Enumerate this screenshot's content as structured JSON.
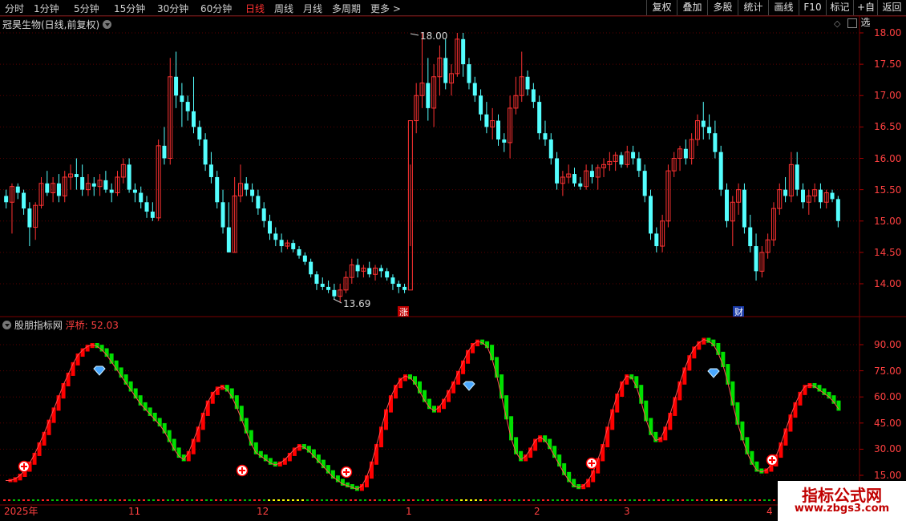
{
  "toolbar": {
    "periods": [
      "分时",
      "1分钟",
      "5分钟",
      "15分钟",
      "30分钟",
      "60分钟",
      "日线",
      "周线",
      "月线",
      "多周期",
      "更多 >"
    ],
    "active_period": "日线",
    "buttons": [
      "复权",
      "叠加",
      "多股",
      "统计",
      "画线",
      "F10",
      "标记",
      "+自选",
      "返回"
    ]
  },
  "main_panel": {
    "title": "冠昊生物(日线,前复权)",
    "high_label": "18.00",
    "low_label": "13.69",
    "zhang_marker": "涨",
    "cai_marker": "财",
    "yaxis": [
      "18.00",
      "17.50",
      "17.00",
      "16.50",
      "16.00",
      "15.50",
      "15.00",
      "14.50",
      "14.00"
    ]
  },
  "indicator_panel": {
    "title": "股朋指标网",
    "value_label": "浮桥: 52.03",
    "yaxis": [
      "90.00",
      "75.00",
      "60.00",
      "45.00",
      "30.00",
      "15.00"
    ]
  },
  "xaxis": [
    "2025年",
    "11",
    "12",
    "1",
    "2",
    "3",
    "4"
  ],
  "watermark": {
    "line1": "指标公式网",
    "line2": "www.zbgs3.com"
  },
  "colors": {
    "up": "#ff3232",
    "down": "#54ffff",
    "ind_up": "#ff0000",
    "ind_down": "#00e000"
  },
  "chart_data": {
    "type": "candlestick",
    "candles": [
      [
        15.4,
        15.5,
        15.2,
        15.3
      ],
      [
        15.3,
        15.6,
        14.8,
        15.55
      ],
      [
        15.55,
        15.6,
        15.35,
        15.45
      ],
      [
        15.45,
        15.5,
        15.1,
        15.2
      ],
      [
        15.2,
        15.3,
        14.6,
        14.9
      ],
      [
        14.9,
        15.3,
        14.7,
        15.25
      ],
      [
        15.25,
        15.7,
        15.2,
        15.6
      ],
      [
        15.6,
        15.8,
        15.4,
        15.45
      ],
      [
        15.45,
        15.7,
        15.3,
        15.6
      ],
      [
        15.6,
        15.75,
        15.3,
        15.4
      ],
      [
        15.4,
        15.8,
        15.3,
        15.7
      ],
      [
        15.7,
        15.9,
        15.5,
        15.75
      ],
      [
        15.75,
        16.0,
        15.5,
        15.7
      ],
      [
        15.7,
        15.9,
        15.4,
        15.5
      ],
      [
        15.5,
        15.75,
        15.4,
        15.6
      ],
      [
        15.6,
        15.7,
        15.4,
        15.55
      ],
      [
        15.55,
        15.75,
        15.4,
        15.65
      ],
      [
        15.65,
        15.8,
        15.45,
        15.5
      ],
      [
        15.5,
        15.6,
        15.3,
        15.45
      ],
      [
        15.45,
        15.8,
        15.4,
        15.7
      ],
      [
        15.7,
        16.0,
        15.6,
        15.9
      ],
      [
        15.9,
        16.0,
        15.45,
        15.5
      ],
      [
        15.5,
        15.6,
        15.3,
        15.45
      ],
      [
        15.45,
        15.55,
        15.2,
        15.3
      ],
      [
        15.3,
        15.4,
        15.05,
        15.15
      ],
      [
        15.15,
        15.3,
        15.0,
        15.05
      ],
      [
        15.05,
        16.3,
        15.0,
        16.2
      ],
      [
        16.2,
        16.5,
        15.9,
        16.0
      ],
      [
        16.0,
        17.6,
        15.9,
        17.3
      ],
      [
        17.3,
        17.7,
        16.8,
        17.0
      ],
      [
        17.0,
        17.2,
        16.5,
        16.9
      ],
      [
        16.9,
        17.0,
        16.6,
        16.75
      ],
      [
        16.75,
        17.3,
        16.4,
        16.5
      ],
      [
        16.5,
        16.6,
        16.2,
        16.3
      ],
      [
        16.3,
        16.4,
        15.8,
        15.9
      ],
      [
        15.9,
        16.1,
        15.6,
        15.7
      ],
      [
        15.7,
        15.8,
        15.2,
        15.3
      ],
      [
        15.3,
        15.5,
        14.8,
        14.9
      ],
      [
        14.9,
        15.3,
        14.5,
        14.5
      ],
      [
        14.5,
        15.7,
        14.5,
        15.4
      ],
      [
        15.4,
        15.9,
        15.3,
        15.6
      ],
      [
        15.6,
        15.7,
        15.4,
        15.5
      ],
      [
        15.5,
        15.6,
        15.3,
        15.4
      ],
      [
        15.4,
        15.5,
        15.1,
        15.2
      ],
      [
        15.2,
        15.3,
        14.9,
        15.0
      ],
      [
        15.0,
        15.1,
        14.7,
        14.8
      ],
      [
        14.8,
        14.9,
        14.6,
        14.7
      ],
      [
        14.7,
        14.8,
        14.5,
        14.6
      ],
      [
        14.6,
        14.7,
        14.55,
        14.65
      ],
      [
        14.65,
        14.7,
        14.5,
        14.55
      ],
      [
        14.55,
        14.6,
        14.4,
        14.45
      ],
      [
        14.45,
        14.5,
        14.3,
        14.35
      ],
      [
        14.35,
        14.4,
        14.1,
        14.15
      ],
      [
        14.15,
        14.2,
        13.9,
        14.0
      ],
      [
        14.0,
        14.1,
        13.9,
        13.95
      ],
      [
        13.95,
        14.05,
        13.85,
        13.9
      ],
      [
        13.9,
        14.0,
        13.75,
        13.8
      ],
      [
        13.8,
        14.0,
        13.7,
        13.9
      ],
      [
        13.9,
        14.2,
        13.85,
        14.1
      ],
      [
        14.1,
        14.4,
        14.0,
        14.3
      ],
      [
        14.3,
        14.4,
        14.1,
        14.2
      ],
      [
        14.2,
        14.3,
        14.1,
        14.25
      ],
      [
        14.25,
        14.35,
        14.1,
        14.15
      ],
      [
        14.15,
        14.3,
        14.05,
        14.25
      ],
      [
        14.25,
        14.3,
        14.1,
        14.2
      ],
      [
        14.2,
        14.25,
        14.05,
        14.1
      ],
      [
        14.1,
        14.15,
        13.9,
        14.0
      ],
      [
        14.0,
        14.05,
        13.85,
        13.95
      ],
      [
        13.95,
        14.0,
        13.85,
        13.9
      ],
      [
        13.9,
        15.9,
        14.6,
        16.6
      ],
      [
        16.6,
        17.2,
        16.4,
        17.0
      ],
      [
        17.0,
        18.0,
        16.8,
        17.2
      ],
      [
        17.2,
        17.6,
        16.6,
        16.8
      ],
      [
        16.8,
        17.5,
        16.5,
        17.3
      ],
      [
        17.3,
        17.8,
        17.0,
        17.6
      ],
      [
        17.6,
        17.9,
        17.1,
        17.2
      ],
      [
        17.2,
        17.5,
        17.0,
        17.35
      ],
      [
        17.35,
        18.0,
        17.3,
        17.9
      ],
      [
        17.9,
        18.0,
        17.3,
        17.5
      ],
      [
        17.5,
        17.6,
        17.1,
        17.2
      ],
      [
        17.2,
        17.3,
        16.9,
        17.0
      ],
      [
        17.0,
        17.1,
        16.6,
        16.7
      ],
      [
        16.7,
        16.9,
        16.4,
        16.5
      ],
      [
        16.5,
        16.8,
        16.3,
        16.6
      ],
      [
        16.6,
        16.7,
        16.2,
        16.3
      ],
      [
        16.3,
        16.4,
        16.1,
        16.25
      ],
      [
        16.25,
        17.0,
        16.0,
        16.8
      ],
      [
        16.8,
        17.3,
        16.7,
        17.0
      ],
      [
        17.0,
        17.7,
        16.9,
        17.3
      ],
      [
        17.3,
        17.4,
        17.0,
        17.1
      ],
      [
        17.1,
        17.2,
        16.8,
        16.9
      ],
      [
        16.9,
        17.0,
        16.3,
        16.4
      ],
      [
        16.4,
        16.6,
        16.2,
        16.3
      ],
      [
        16.3,
        16.4,
        15.9,
        16.0
      ],
      [
        16.0,
        16.1,
        15.5,
        15.6
      ],
      [
        15.6,
        15.8,
        15.4,
        15.7
      ],
      [
        15.7,
        15.9,
        15.6,
        15.75
      ],
      [
        15.75,
        15.85,
        15.55,
        15.6
      ],
      [
        15.6,
        15.7,
        15.5,
        15.55
      ],
      [
        15.55,
        15.9,
        15.5,
        15.8
      ],
      [
        15.8,
        15.9,
        15.6,
        15.7
      ],
      [
        15.7,
        15.9,
        15.5,
        15.85
      ],
      [
        15.85,
        16.0,
        15.7,
        15.9
      ],
      [
        15.9,
        16.1,
        15.8,
        15.95
      ],
      [
        15.95,
        16.1,
        15.8,
        16.05
      ],
      [
        16.05,
        16.1,
        15.85,
        15.9
      ],
      [
        15.9,
        16.2,
        15.85,
        16.1
      ],
      [
        16.1,
        16.2,
        15.9,
        16.0
      ],
      [
        16.0,
        16.1,
        15.7,
        15.8
      ],
      [
        15.8,
        15.9,
        15.3,
        15.4
      ],
      [
        15.4,
        15.5,
        14.7,
        14.8
      ],
      [
        14.8,
        14.9,
        14.5,
        14.6
      ],
      [
        14.6,
        15.1,
        14.5,
        15.0
      ],
      [
        15.0,
        15.9,
        14.9,
        15.8
      ],
      [
        15.8,
        16.1,
        15.7,
        16.0
      ],
      [
        16.0,
        16.2,
        15.8,
        16.15
      ],
      [
        16.15,
        16.3,
        15.9,
        16.0
      ],
      [
        16.0,
        16.4,
        15.9,
        16.3
      ],
      [
        16.3,
        16.7,
        16.2,
        16.6
      ],
      [
        16.6,
        16.9,
        16.3,
        16.5
      ],
      [
        16.5,
        16.7,
        16.3,
        16.4
      ],
      [
        16.4,
        16.6,
        16.0,
        16.1
      ],
      [
        16.1,
        16.2,
        15.4,
        15.5
      ],
      [
        15.5,
        15.6,
        14.9,
        15.0
      ],
      [
        15.0,
        15.4,
        14.6,
        15.3
      ],
      [
        15.3,
        15.6,
        15.1,
        15.5
      ],
      [
        15.5,
        15.6,
        14.8,
        14.9
      ],
      [
        14.9,
        15.1,
        14.5,
        14.6
      ],
      [
        14.6,
        14.8,
        14.05,
        14.2
      ],
      [
        14.2,
        14.6,
        14.1,
        14.5
      ],
      [
        14.5,
        14.8,
        14.4,
        14.7
      ],
      [
        14.7,
        15.3,
        14.6,
        15.2
      ],
      [
        15.2,
        15.6,
        15.1,
        15.5
      ],
      [
        15.5,
        15.7,
        15.3,
        15.4
      ],
      [
        15.4,
        16.1,
        15.3,
        15.9
      ],
      [
        15.9,
        16.1,
        15.4,
        15.5
      ],
      [
        15.5,
        15.6,
        15.2,
        15.3
      ],
      [
        15.3,
        15.5,
        15.1,
        15.4
      ],
      [
        15.4,
        15.6,
        15.3,
        15.5
      ],
      [
        15.5,
        15.6,
        15.2,
        15.3
      ],
      [
        15.3,
        15.5,
        15.2,
        15.45
      ],
      [
        15.45,
        15.5,
        15.3,
        15.35
      ],
      [
        15.35,
        15.4,
        14.9,
        15.0
      ]
    ],
    "indicator": [
      12,
      12,
      13,
      15,
      18,
      22,
      27,
      33,
      39,
      46,
      53,
      60,
      67,
      73,
      79,
      84,
      87,
      89,
      90,
      89,
      87,
      84,
      80,
      76,
      72,
      68,
      64,
      60,
      56,
      53,
      50,
      47,
      44,
      40,
      35,
      30,
      26,
      24,
      28,
      35,
      42,
      50,
      57,
      62,
      65,
      66,
      64,
      60,
      54,
      47,
      40,
      33,
      28,
      26,
      24,
      22,
      21,
      22,
      24,
      27,
      30,
      32,
      31,
      29,
      26,
      23,
      20,
      17,
      14,
      12,
      10,
      9,
      8,
      7,
      9,
      14,
      22,
      32,
      42,
      52,
      60,
      66,
      70,
      72,
      71,
      68,
      63,
      58,
      54,
      52,
      54,
      58,
      63,
      68,
      74,
      80,
      86,
      90,
      92,
      91,
      89,
      82,
      72,
      60,
      48,
      36,
      28,
      24,
      26,
      30,
      35,
      37,
      35,
      31,
      26,
      21,
      16,
      12,
      9,
      8,
      9,
      12,
      17,
      24,
      32,
      42,
      52,
      61,
      68,
      72,
      71,
      66,
      57,
      47,
      39,
      35,
      36,
      42,
      50,
      59,
      68,
      76,
      83,
      88,
      91,
      93,
      92,
      90,
      85,
      78,
      68,
      56,
      45,
      36,
      28,
      22,
      18,
      17,
      18,
      21,
      26,
      33,
      41,
      49,
      56,
      62,
      66,
      67,
      66,
      64,
      62,
      60,
      57,
      53
    ]
  }
}
